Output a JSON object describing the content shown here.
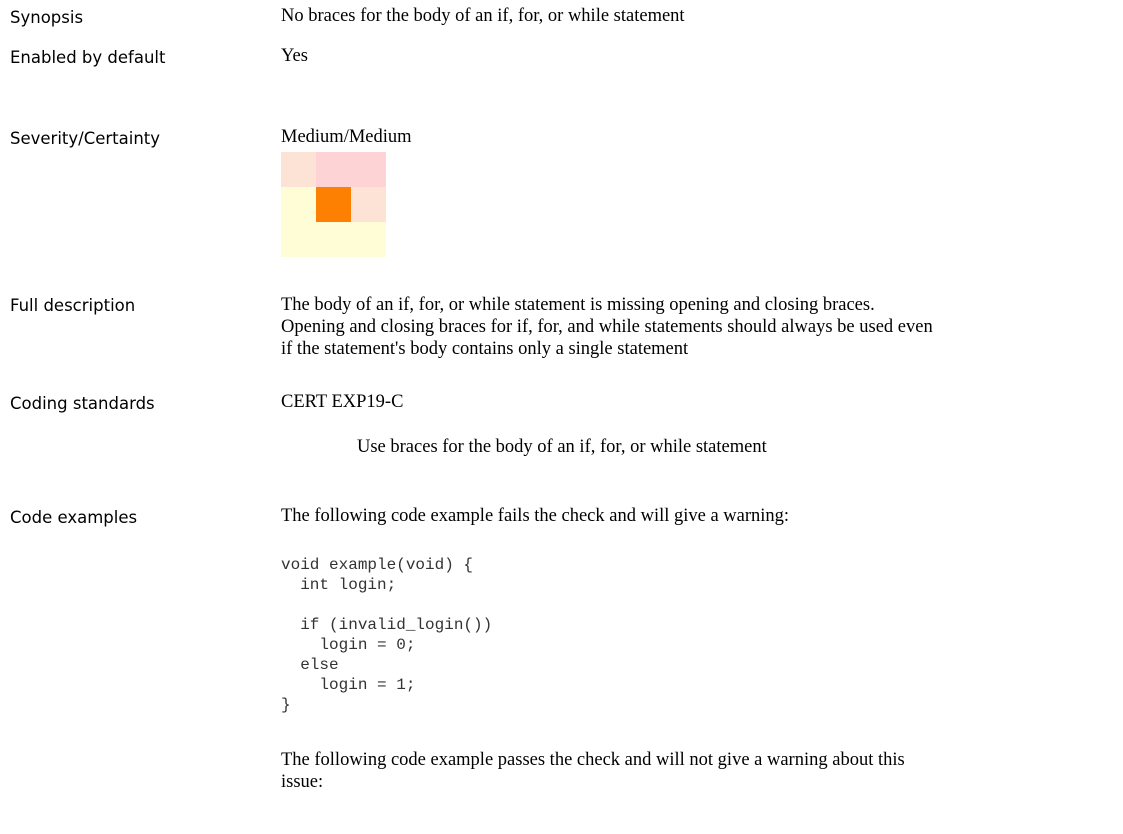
{
  "rows": {
    "synopsis": {
      "label": "Synopsis",
      "value": "No braces for the body of an if, for, or while statement"
    },
    "enabled": {
      "label": "Enabled by default",
      "value": "Yes"
    },
    "severity": {
      "label": "Severity/Certainty",
      "value": "Medium/Medium",
      "matrix_colors": [
        [
          "#fde2d6",
          "#fdd3d6",
          "#fdd3d6"
        ],
        [
          "#fffdd6",
          "#fe8003",
          "#fde2d6"
        ],
        [
          "#fffdd6",
          "#fffdd6",
          "#fffdd6"
        ]
      ]
    },
    "full_description": {
      "label": "Full description",
      "lines": [
        "The body of an if, for, or while statement is missing opening and closing braces.",
        "Opening and closing braces for if, for, and while statements should always be used even",
        "if the statement's body contains only a single statement"
      ]
    },
    "coding_standards": {
      "label": "Coding standards",
      "value": "CERT EXP19-C",
      "note": "Use braces for the body of an if, for, or while statement"
    },
    "code_examples": {
      "label": "Code examples",
      "intro": "The following code example fails the check and will give a warning:",
      "code": "void example(void) {\n  int login;\n\n  if (invalid_login())\n    login = 0;\n  else\n    login = 1;\n}",
      "outro_lines": [
        "The following code example passes the check and will not give a warning about this",
        "issue:"
      ]
    }
  }
}
